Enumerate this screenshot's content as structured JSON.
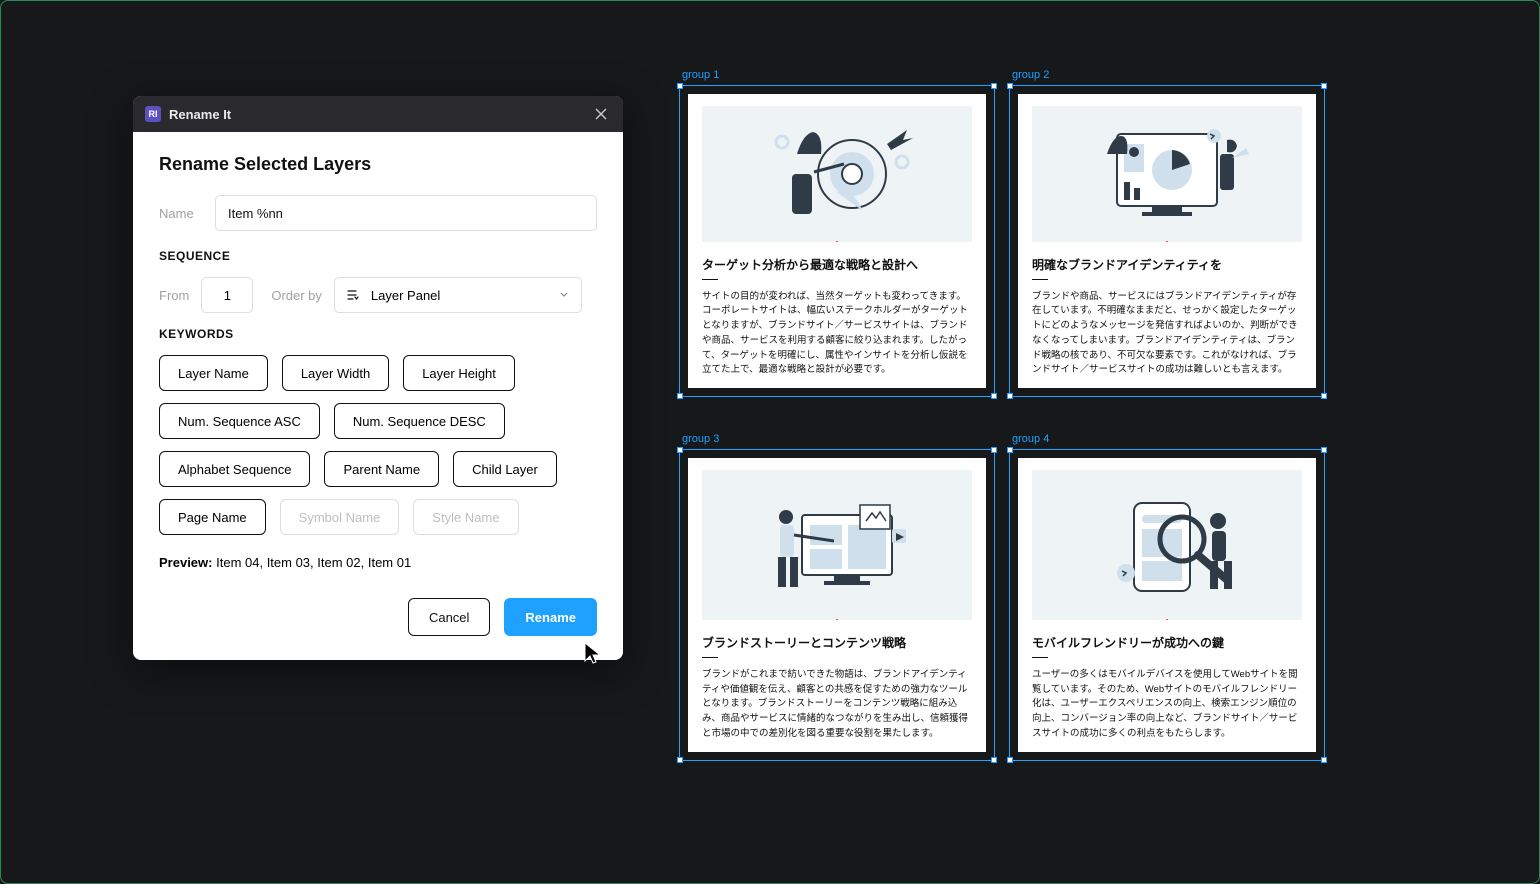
{
  "dialog": {
    "logo_text": "RI",
    "title": "Rename It",
    "heading": "Rename Selected Layers",
    "name_label": "Name",
    "name_value": "Item %nn",
    "sequence_label": "SEQUENCE",
    "from_label": "From",
    "from_value": "1",
    "order_by_label": "Order by",
    "select_value": "Layer Panel",
    "keywords_label": "KEYWORDS",
    "chips": [
      {
        "label": "Layer Name",
        "disabled": false
      },
      {
        "label": "Layer Width",
        "disabled": false
      },
      {
        "label": "Layer Height",
        "disabled": false
      },
      {
        "label": "Num. Sequence ASC",
        "disabled": false
      },
      {
        "label": "Num. Sequence DESC",
        "disabled": false
      },
      {
        "label": "Alphabet Sequence",
        "disabled": false
      },
      {
        "label": "Parent Name",
        "disabled": false
      },
      {
        "label": "Child Layer",
        "disabled": false
      },
      {
        "label": "Page Name",
        "disabled": false
      },
      {
        "label": "Symbol Name",
        "disabled": true
      },
      {
        "label": "Style Name",
        "disabled": true
      }
    ],
    "preview_label": "Preview:",
    "preview_value": "Item 04, Item 03, Item 02, Item 01",
    "cancel_label": "Cancel",
    "rename_label": "Rename"
  },
  "groups": [
    {
      "label": "group 1",
      "title": "ターゲット分析から最適な戦略と設計へ",
      "body": "サイトの目的が変われば、当然ターゲットも変わってきます。コーポレートサイトは、幅広いステークホルダーがターゲットとなりますが、ブランドサイト／サービスサイトは、ブランドや商品、サービスを利用する顧客に絞り込まれます。したがって、ターゲットを明確にし、属性やインサイトを分析し仮説を立てた上で、最適な戦略と設計が必要です。"
    },
    {
      "label": "group 2",
      "title": "明確なブランドアイデンティティを",
      "body": "ブランドや商品、サービスにはブランドアイデンティティが存在しています。不明確なままだと、せっかく設定したターゲットにどのようなメッセージを発信すればよいのか、判断ができなくなってしまいます。ブランドアイデンティティは、ブランド戦略の核であり、不可欠な要素です。これがなければ、ブランドサイト／サービスサイトの成功は難しいとも言えます。"
    },
    {
      "label": "group 3",
      "title": "ブランドストーリーとコンテンツ戦略",
      "body": "ブランドがこれまで紡いできた物語は、ブランドアイデンティティや価値観を伝え、顧客との共感を促すための強力なツールとなります。ブランドストーリーをコンテンツ戦略に組み込み、商品やサービスに情緒的なつながりを生み出し、信頼獲得と市場の中での差別化を図る重要な役割を果たします。"
    },
    {
      "label": "group 4",
      "title": "モバイルフレンドリーが成功への鍵",
      "body": "ユーザーの多くはモバイルデバイスを使用してWebサイトを閲覧しています。そのため、Webサイトのモバイルフレンドリー化は、ユーザーエクスペリエンスの向上、検索エンジン順位の向上、コンバージョン率の向上など、ブランドサイト／サービスサイトの成功に多くの利点をもたらします。"
    }
  ]
}
